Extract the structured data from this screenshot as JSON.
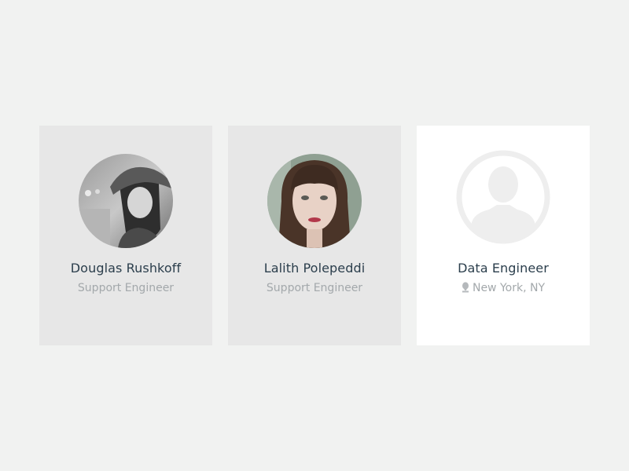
{
  "cards": [
    {
      "name": "Douglas Rushkoff",
      "role": "Support Engineer",
      "avatar": "photo"
    },
    {
      "name": "Lalith Polepeddi",
      "role": "Support Engineer",
      "avatar": "photo"
    },
    {
      "title": "Data Engineer",
      "location": "New York, NY",
      "avatar": "placeholder-user-icon",
      "location_icon": "map-pin-icon"
    }
  ],
  "colors": {
    "page_background": "#f1f2f1",
    "member_card_background": "#e7e7e7",
    "open_card_background": "#ffffff",
    "name_text": "#2b3e4c",
    "subtitle_text": "#a3a8ab",
    "placeholder_gray": "#eeeeee"
  }
}
